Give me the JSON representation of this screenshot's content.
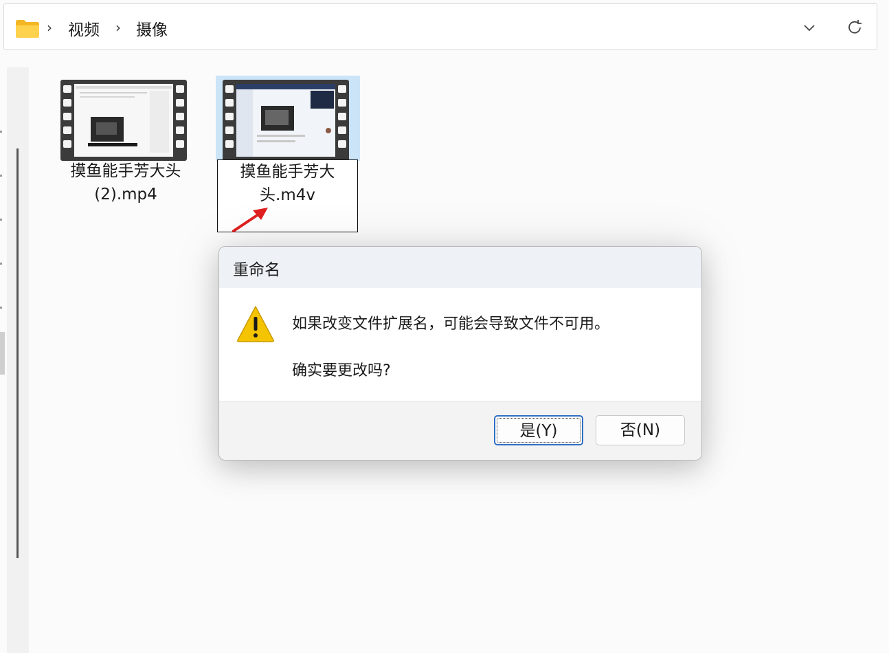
{
  "address_bar": {
    "folder_icon": "folder-icon",
    "separator": "›",
    "crumbs": [
      "视频",
      "摄像"
    ],
    "chevron_icon": "chevron-down-icon",
    "refresh_icon": "refresh-icon"
  },
  "files": [
    {
      "name": "摸鱼能手芳大头\n(2).mp4",
      "icon": "video-thumbnail-icon",
      "selected": false
    },
    {
      "name": "摸鱼能手芳大\n头.m4v",
      "icon": "video-thumbnail-icon",
      "selected": true,
      "renaming": true
    }
  ],
  "annotation": {
    "icon": "red-arrow-icon",
    "color": "#e02020"
  },
  "dialog": {
    "title": "重命名",
    "icon": "warning-icon",
    "message": "如果改变文件扩展名，可能会导致文件不可用。",
    "question": "确实要更改吗?",
    "yes_label": "是(Y)",
    "no_label": "否(N)"
  },
  "colors": {
    "selection": "#cce4f7",
    "default_button_border": "#2f6fc4",
    "warning": "#f5c400"
  }
}
